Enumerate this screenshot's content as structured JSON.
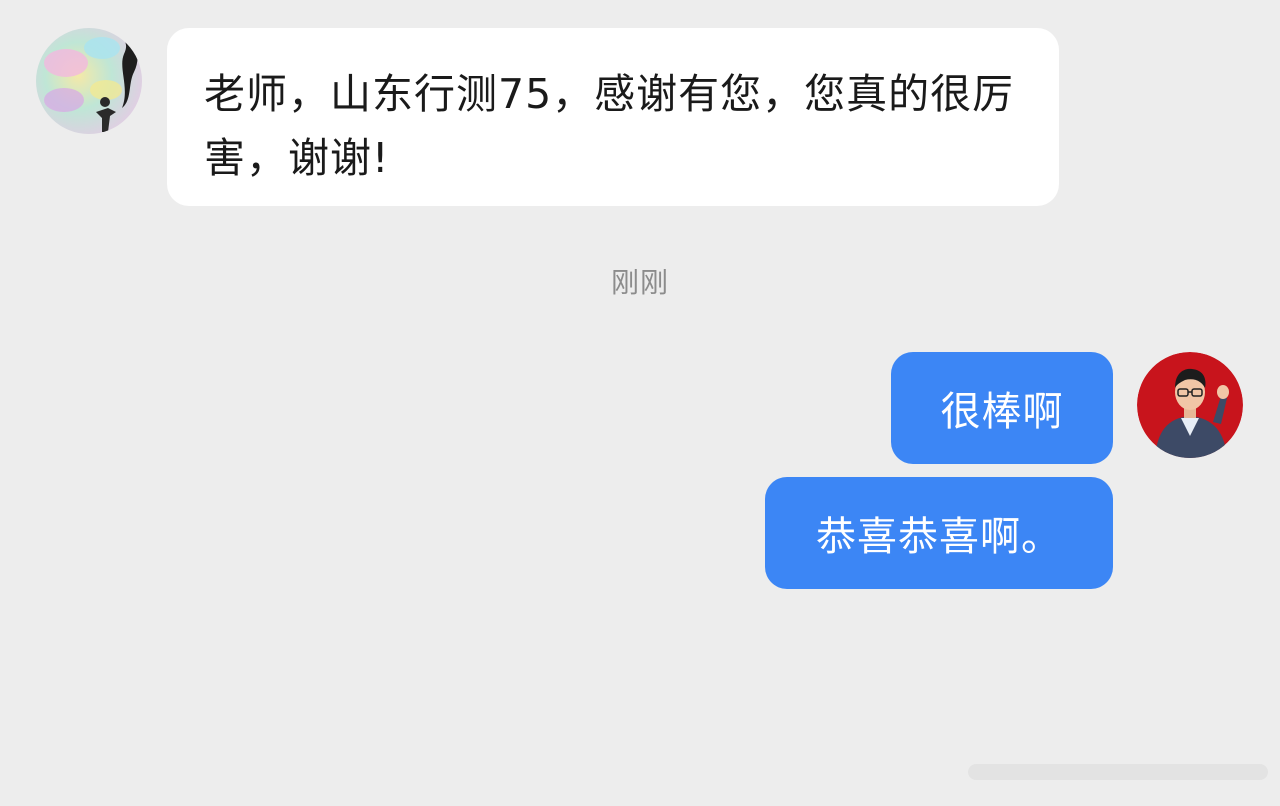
{
  "chat": {
    "incoming": {
      "text": "老师，山东行测75，感谢有您，您真的很厉害，谢谢!"
    },
    "timestamp": "刚刚",
    "outgoing": [
      {
        "text": "很棒啊"
      },
      {
        "text": "恭喜恭喜啊。"
      }
    ]
  },
  "colors": {
    "background": "#ededed",
    "incoming_bubble": "#ffffff",
    "outgoing_bubble": "#3c86f5",
    "right_avatar_bg": "#c8141c"
  },
  "icons": {
    "left_avatar": "user-avatar-pastel-illustration",
    "right_avatar": "teacher-avatar-photo"
  }
}
